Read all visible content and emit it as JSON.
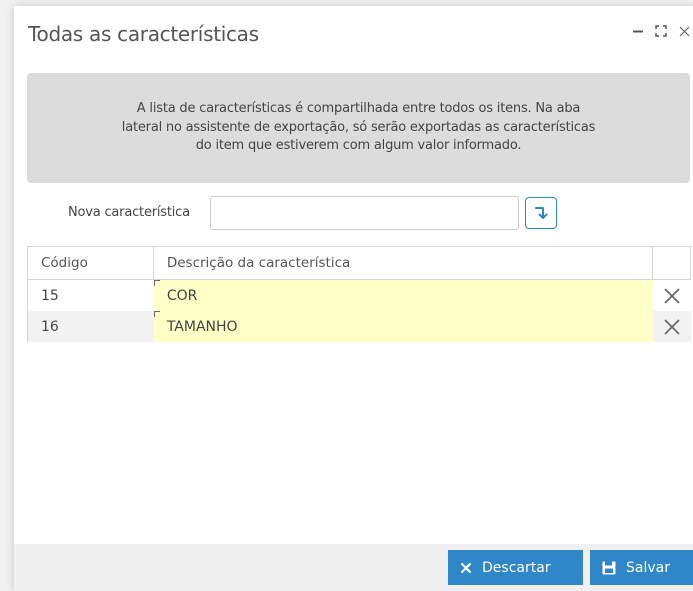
{
  "dialog": {
    "title": "Todas as características",
    "controls": [
      "minimize-icon",
      "maximize-icon",
      "close-icon"
    ]
  },
  "info": {
    "line1": "A lista de características é compartilhada entre todos os itens. Na aba",
    "line2": "lateral no assistente de exportação, só serão exportadas as características",
    "line3": "do item que estiverem com algum valor informado."
  },
  "new_characteristic": {
    "label": "Nova característica",
    "value": "",
    "add_icon": "arrow-down-return-icon"
  },
  "grid": {
    "columns": [
      "Código",
      "Descrição da característica"
    ],
    "rows": [
      {
        "code": "15",
        "description": "COR"
      },
      {
        "code": "16",
        "description": "TAMANHO"
      }
    ]
  },
  "footer": {
    "discard_label": "Descartar",
    "save_label": "Salvar"
  },
  "colors": {
    "accent": "#2f86c9",
    "editable_cell": "#ffffc8",
    "info_bg": "#dcdcdc"
  }
}
